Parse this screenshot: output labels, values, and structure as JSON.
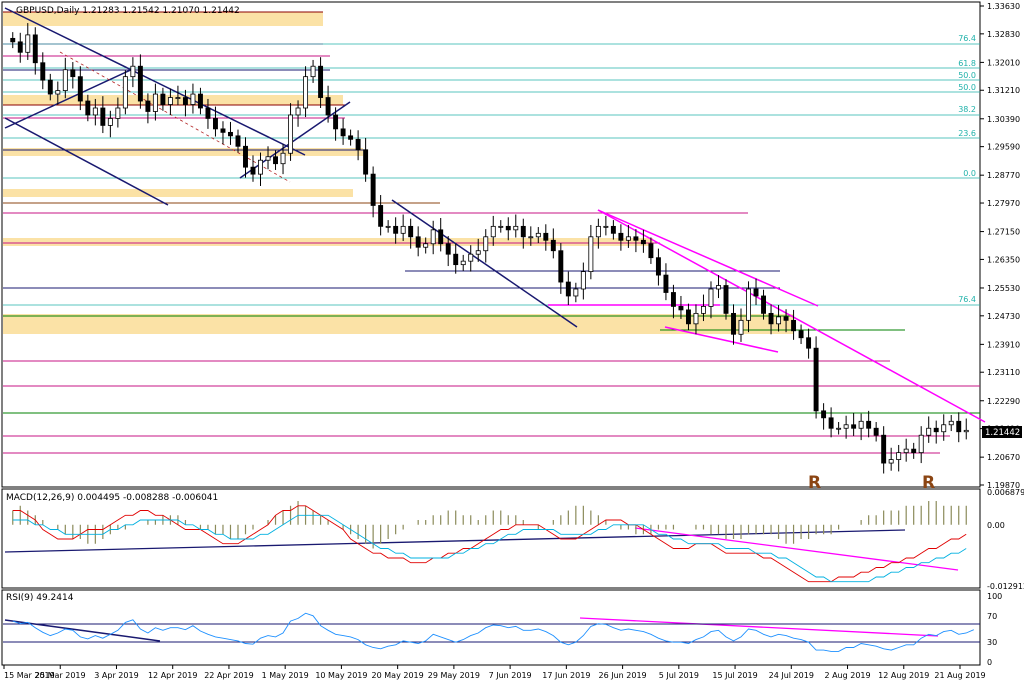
{
  "chart_data": {
    "type": "candlestick",
    "title": "GBPUSD,Daily  1.21283 1.21542 1.21070 1.21442",
    "last_price": "1.21442",
    "price_ticks": [
      "1.33630",
      "1.32830",
      "1.32010",
      "1.31210",
      "1.30390",
      "1.29590",
      "1.28770",
      "1.27970",
      "1.27150",
      "1.26350",
      "1.25530",
      "1.24730",
      "1.23910",
      "1.23110",
      "1.22290",
      "1.21490",
      "1.20670",
      "1.19870"
    ],
    "ylim": [
      1.1987,
      1.3363
    ],
    "date_labels": [
      "15 Mar 2019",
      "25 Mar 2019",
      "3 Apr 2019",
      "12 Apr 2019",
      "22 Apr 2019",
      "1 May 2019",
      "10 May 2019",
      "20 May 2019",
      "29 May 2019",
      "7 Jun 2019",
      "17 Jun 2019",
      "26 Jun 2019",
      "5 Jul 2019",
      "15 Jul 2019",
      "24 Jul 2019",
      "2 Aug 2019",
      "12 Aug 2019",
      "21 Aug 2019"
    ],
    "fib_labels": [
      "76.4",
      "61.8",
      "50.0",
      "50.0",
      "38.2",
      "23.6",
      "0.0",
      "76.4"
    ],
    "pattern_labels": [
      "R",
      "R"
    ],
    "closes": [
      1.326,
      1.323,
      1.328,
      1.32,
      1.315,
      1.311,
      1.312,
      1.318,
      1.316,
      1.309,
      1.305,
      1.307,
      1.302,
      1.304,
      1.307,
      1.316,
      1.319,
      1.309,
      1.306,
      1.311,
      1.308,
      1.31,
      1.31,
      1.308,
      1.311,
      1.307,
      1.304,
      1.301,
      1.3,
      1.299,
      1.296,
      1.29,
      1.288,
      1.292,
      1.293,
      1.291,
      1.294,
      1.305,
      1.307,
      1.316,
      1.319,
      1.31,
      1.305,
      1.301,
      1.299,
      1.298,
      1.295,
      1.288,
      1.279,
      1.273,
      1.273,
      1.271,
      1.273,
      1.27,
      1.267,
      1.268,
      1.272,
      1.268,
      1.265,
      1.262,
      1.263,
      1.265,
      1.266,
      1.27,
      1.273,
      1.273,
      1.272,
      1.273,
      1.27,
      1.27,
      1.271,
      1.269,
      1.266,
      1.257,
      1.253,
      1.255,
      1.26,
      1.27,
      1.273,
      1.273,
      1.271,
      1.269,
      1.27,
      1.269,
      1.268,
      1.264,
      1.259,
      1.254,
      1.25,
      1.249,
      1.245,
      1.248,
      1.25,
      1.255,
      1.256,
      1.248,
      1.242,
      1.246,
      1.255,
      1.253,
      1.248,
      1.245,
      1.247,
      1.246,
      1.243,
      1.241,
      1.238,
      1.22,
      1.218,
      1.215,
      1.215,
      1.216,
      1.215,
      1.217,
      1.215,
      1.213,
      1.205,
      1.206,
      1.208,
      1.209,
      1.208,
      1.213,
      1.215,
      1.214,
      1.216,
      1.217,
      1.214,
      1.2144
    ],
    "macd": {
      "label": "MACD(12,26,9) 0.004495 -0.008288 -0.006041",
      "ticks": [
        "0.006879",
        "0.00",
        "-0.012912"
      ],
      "ylim": [
        -0.0129,
        0.0069
      ],
      "histogram": [
        0.003,
        0.004,
        0.003,
        0.002,
        0.001,
        0.0,
        -0.001,
        -0.002,
        -0.003,
        -0.003,
        -0.004,
        -0.004,
        -0.003,
        -0.002,
        -0.001,
        -0.001,
        0.0,
        0.0,
        0.001,
        0.001,
        0.002,
        0.002,
        0.002,
        0.001,
        0.0,
        -0.001,
        -0.001,
        -0.002,
        -0.002,
        -0.003,
        -0.003,
        -0.002,
        -0.001,
        0.0,
        0.001,
        0.002,
        0.003,
        0.004,
        0.005,
        0.004,
        0.003,
        0.002,
        0.001,
        0.0,
        -0.001,
        -0.002,
        -0.003,
        -0.004,
        -0.005,
        -0.004,
        -0.003,
        -0.002,
        -0.001,
        0.0,
        0.001,
        0.001,
        0.002,
        0.002,
        0.003,
        0.003,
        0.002,
        0.002,
        0.001,
        0.002,
        0.003,
        0.003,
        0.002,
        0.002,
        0.001,
        0.0,
        -0.001,
        0.0,
        0.001,
        0.002,
        0.003,
        0.004,
        0.004,
        0.003,
        0.002,
        0.001,
        0.0,
        -0.001,
        -0.001,
        -0.002,
        -0.002,
        -0.002,
        -0.001,
        -0.001,
        -0.001,
        0.0,
        0.0,
        -0.001,
        -0.001,
        -0.002,
        -0.002,
        -0.003,
        -0.003,
        -0.003,
        -0.002,
        -0.002,
        -0.002,
        -0.002,
        -0.003,
        -0.004,
        -0.004,
        -0.003,
        -0.003,
        -0.002,
        -0.002,
        -0.002,
        -0.001,
        0.0,
        0.0,
        0.001,
        0.002,
        0.002,
        0.003,
        0.003,
        0.003,
        0.004,
        0.004,
        0.004,
        0.005,
        0.005,
        0.004,
        0.004,
        0.004,
        0.004
      ],
      "signal_divergence_label": "",
      "macd_line": [
        0.003,
        0.003,
        0.002,
        0.001,
        -0.001,
        -0.002,
        -0.003,
        -0.003,
        -0.003,
        -0.002,
        -0.001,
        -0.001,
        -0.001,
        0.0,
        0.001,
        0.002,
        0.002,
        0.003,
        0.003,
        0.002,
        0.002,
        0.001,
        0.0,
        -0.001,
        -0.001,
        -0.001,
        -0.002,
        -0.003,
        -0.004,
        -0.004,
        -0.004,
        -0.003,
        -0.002,
        -0.001,
        0.0,
        0.002,
        0.003,
        0.003,
        0.004,
        0.004,
        0.003,
        0.002,
        0.001,
        0.0,
        -0.001,
        -0.003,
        -0.004,
        -0.005,
        -0.006,
        -0.006,
        -0.007,
        -0.007,
        -0.007,
        -0.008,
        -0.008,
        -0.008,
        -0.007,
        -0.007,
        -0.006,
        -0.006,
        -0.005,
        -0.005,
        -0.004,
        -0.003,
        -0.002,
        -0.001,
        -0.001,
        0.0,
        0.0,
        0.0,
        0.0,
        -0.001,
        -0.002,
        -0.003,
        -0.003,
        -0.003,
        -0.002,
        -0.001,
        0.0,
        0.001,
        0.001,
        0.001,
        0.0,
        0.0,
        -0.001,
        -0.002,
        -0.003,
        -0.004,
        -0.005,
        -0.005,
        -0.005,
        -0.004,
        -0.004,
        -0.004,
        -0.005,
        -0.006,
        -0.006,
        -0.006,
        -0.006,
        -0.006,
        -0.007,
        -0.007,
        -0.008,
        -0.009,
        -0.01,
        -0.011,
        -0.012,
        -0.012,
        -0.012,
        -0.012,
        -0.011,
        -0.011,
        -0.011,
        -0.01,
        -0.01,
        -0.009,
        -0.009,
        -0.008,
        -0.008,
        -0.007,
        -0.007,
        -0.006,
        -0.005,
        -0.005,
        -0.004,
        -0.003,
        -0.003,
        -0.002
      ],
      "signal_line": [
        0.001,
        0.001,
        0.001,
        0.0,
        0.0,
        -0.001,
        -0.001,
        -0.002,
        -0.002,
        -0.002,
        -0.002,
        -0.002,
        -0.002,
        -0.001,
        -0.001,
        0.0,
        0.0,
        0.001,
        0.001,
        0.001,
        0.001,
        0.001,
        0.001,
        0.0,
        0.0,
        -0.001,
        -0.001,
        -0.002,
        -0.002,
        -0.003,
        -0.003,
        -0.003,
        -0.003,
        -0.002,
        -0.002,
        -0.001,
        0.0,
        0.001,
        0.002,
        0.002,
        0.002,
        0.002,
        0.002,
        0.001,
        0.0,
        -0.001,
        -0.002,
        -0.003,
        -0.004,
        -0.005,
        -0.005,
        -0.006,
        -0.006,
        -0.007,
        -0.007,
        -0.007,
        -0.007,
        -0.007,
        -0.007,
        -0.006,
        -0.006,
        -0.005,
        -0.005,
        -0.004,
        -0.004,
        -0.003,
        -0.002,
        -0.002,
        -0.001,
        -0.001,
        -0.001,
        -0.001,
        -0.001,
        -0.002,
        -0.002,
        -0.002,
        -0.002,
        -0.002,
        -0.001,
        -0.001,
        0.0,
        0.0,
        0.0,
        0.0,
        0.0,
        -0.001,
        -0.002,
        -0.002,
        -0.003,
        -0.003,
        -0.004,
        -0.004,
        -0.004,
        -0.004,
        -0.004,
        -0.005,
        -0.005,
        -0.005,
        -0.005,
        -0.006,
        -0.006,
        -0.006,
        -0.007,
        -0.007,
        -0.008,
        -0.009,
        -0.01,
        -0.011,
        -0.011,
        -0.012,
        -0.012,
        -0.012,
        -0.012,
        -0.012,
        -0.012,
        -0.011,
        -0.011,
        -0.01,
        -0.01,
        -0.009,
        -0.009,
        -0.008,
        -0.008,
        -0.007,
        -0.007,
        -0.006,
        -0.006,
        -0.005
      ]
    },
    "rsi": {
      "label": "RSI(9) 49.2414",
      "ticks": [
        "100",
        "70",
        "30",
        "0"
      ],
      "ylim": [
        0,
        100
      ],
      "values": [
        62,
        58,
        60,
        52,
        45,
        40,
        44,
        50,
        48,
        38,
        35,
        40,
        36,
        42,
        48,
        60,
        64,
        50,
        44,
        52,
        48,
        52,
        52,
        49,
        55,
        47,
        42,
        38,
        36,
        34,
        32,
        28,
        27,
        36,
        40,
        38,
        44,
        62,
        66,
        74,
        70,
        55,
        48,
        42,
        40,
        38,
        34,
        26,
        22,
        20,
        24,
        26,
        32,
        30,
        28,
        32,
        42,
        38,
        34,
        30,
        34,
        40,
        44,
        52,
        56,
        55,
        52,
        54,
        48,
        48,
        50,
        46,
        40,
        30,
        26,
        30,
        40,
        54,
        58,
        57,
        52,
        48,
        50,
        48,
        46,
        42,
        36,
        32,
        30,
        30,
        28,
        34,
        38,
        46,
        48,
        38,
        32,
        38,
        50,
        48,
        42,
        38,
        42,
        40,
        36,
        34,
        30,
        18,
        18,
        16,
        16,
        22,
        22,
        28,
        26,
        24,
        20,
        18,
        22,
        26,
        26,
        36,
        42,
        40,
        46,
        48,
        42,
        44,
        49
      ]
    }
  }
}
